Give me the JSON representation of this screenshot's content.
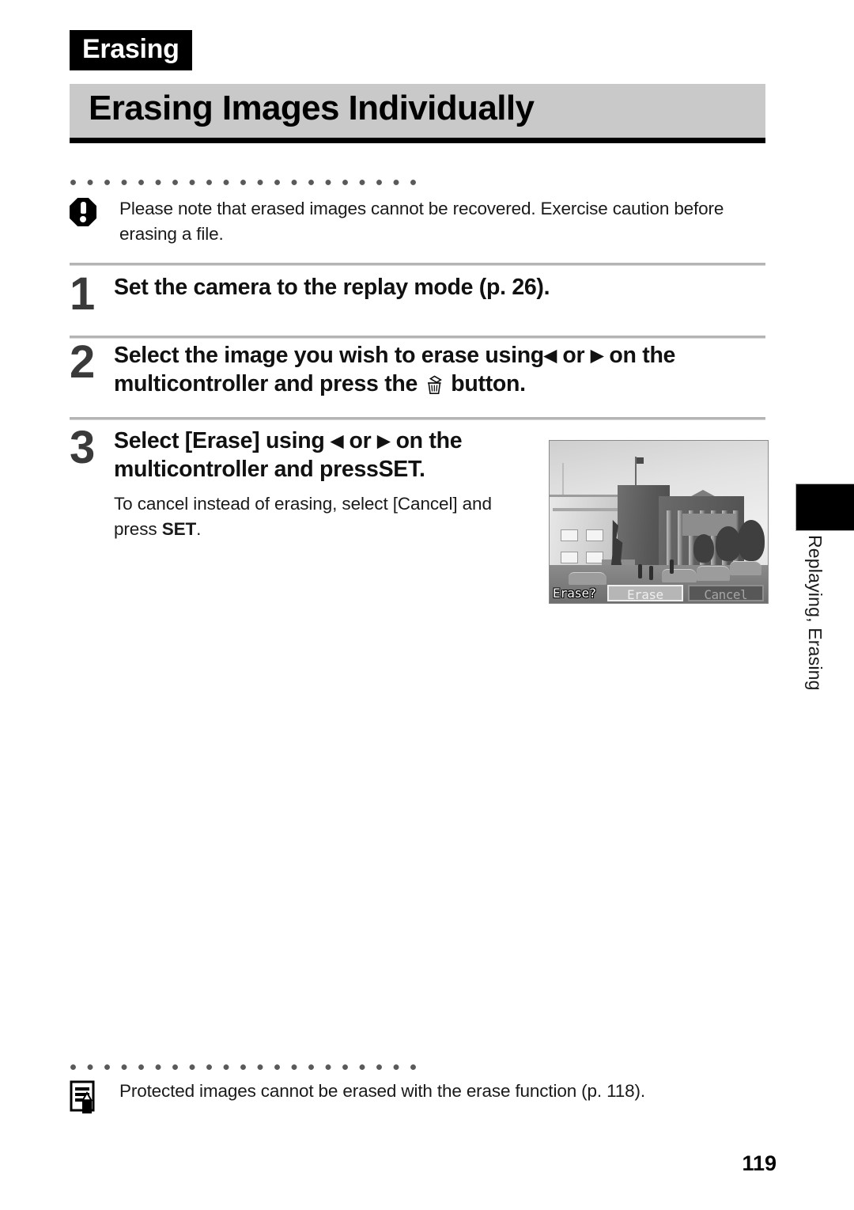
{
  "document": {
    "section_label": "Erasing",
    "page_title": "Erasing Images Individually",
    "page_number": "119",
    "side_tab_label": "Replaying, Erasing"
  },
  "caution_note": {
    "icon": "caution-octagon-icon",
    "text": "Please note that erased images cannot be recovered. Exercise caution before erasing a file."
  },
  "steps": [
    {
      "number": "1",
      "title": "Set the camera to the replay mode (p. 26).",
      "sub": ""
    },
    {
      "number": "2",
      "title_part1": "Select the image you wish to erase using",
      "arrow_left": "◀",
      "or": "or",
      "arrow_right": "▶",
      "title_part2": "on the multicontroller and press the",
      "icon": "trash-can-icon",
      "title_part3": "button.",
      "sub": ""
    },
    {
      "number": "3",
      "title_part1": "Select [Erase] using",
      "arrow_left": "◀",
      "or": "or",
      "arrow_right": "▶",
      "title_part2": "on the multicontroller and press",
      "set_label": "SET",
      "title_part3": ".",
      "sub_part1": "To cancel instead of erasing, select [Cancel] and press",
      "sub_set_label": "SET",
      "sub_part2": "."
    }
  ],
  "lcd_screenshot": {
    "prompt": "Erase?",
    "buttons": [
      {
        "label": "Erase",
        "state": "selected"
      },
      {
        "label": "Cancel",
        "state": "unselected"
      }
    ]
  },
  "memo_note": {
    "icon": "memo-pencil-icon",
    "text": "Protected images cannot be erased with the erase function (p. 118)."
  },
  "colors": {
    "title_bar_bg": "#c9c9c9",
    "badge_bg": "#000000",
    "step_number": "#3a3a3a",
    "separator": "#b4b4b4",
    "dot": "#5a5a5a"
  }
}
